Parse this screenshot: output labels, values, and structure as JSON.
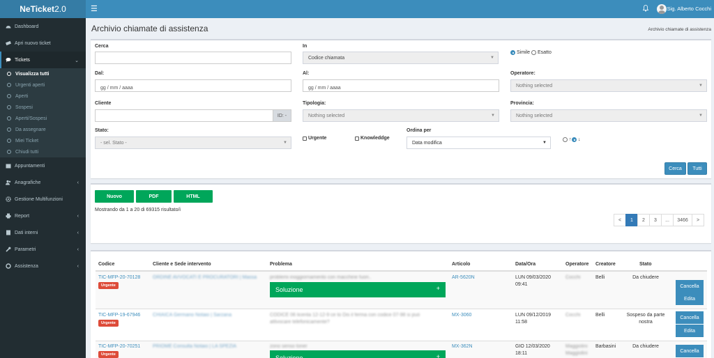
{
  "app": {
    "logo_bold": "NeTicket",
    "logo_ver": "2.0",
    "user": "Sig. Alberto Cocchi"
  },
  "sidebar": {
    "items": [
      {
        "label": "Dashboard",
        "icon": "dashboard-icon"
      },
      {
        "label": "Apri nuovo ticket",
        "icon": "ticket-icon"
      },
      {
        "label": "Tickets",
        "icon": "comments-icon"
      },
      {
        "label": "Appuntamenti",
        "icon": "calendar-icon"
      },
      {
        "label": "Anagrafiche",
        "icon": "users-icon"
      },
      {
        "label": "Gestione Multifunzioni",
        "icon": "cog-icon"
      },
      {
        "label": "Report",
        "icon": "print-icon"
      },
      {
        "label": "Dati interni",
        "icon": "book-icon"
      },
      {
        "label": "Parametri",
        "icon": "wrench-icon"
      },
      {
        "label": "Assistenza",
        "icon": "lifebuoy-icon"
      }
    ],
    "sub": [
      "Visualizza tutti",
      "Urgenti aperti",
      "Aperti",
      "Sospesi",
      "Aperti/Sospesi",
      "Da assegnare",
      "Miei Ticket",
      "Chiudi tutti"
    ]
  },
  "page": {
    "title": "Archivio chiamate di assistenza",
    "breadcrumb": "Archivio chiamate di assistenza"
  },
  "filters": {
    "cerca_label": "Cerca",
    "in_label": "In",
    "in_value": "Codice chiamata",
    "simile": "Simile",
    "esatto": "Esatto",
    "dal_label": "Dal:",
    "al_label": "Al:",
    "date_placeholder": "gg / mm / aaaa",
    "operatore_label": "Operatore:",
    "nothing": "Nothing selected",
    "cliente_label": "Cliente",
    "id_addon": "ID: -",
    "tipologia_label": "Tipologia:",
    "provincia_label": "Provincia:",
    "stato_label": "Stato:",
    "stato_value": "- sel. Stato -",
    "urgente": "Urgente",
    "knowleddge": "Knowleddge",
    "ordina_label": "Ordina per",
    "ordina_value": "Data modifica",
    "cerca_btn": "Cerca",
    "tutti_btn": "Tutti"
  },
  "results": {
    "nuovo": "Nuovo",
    "pdf": "PDF",
    "html": "HTML",
    "summary": "Mostrando da 1 a 20 di 69315 risultato/i",
    "pages": [
      "<",
      "1",
      "2",
      "3",
      "...",
      "3466",
      ">"
    ],
    "current_page": "1"
  },
  "table": {
    "headers": [
      "Codice",
      "Cliente e Sede intervento",
      "Problema",
      "Articolo",
      "Data/Ora",
      "Operatore",
      "Creatore",
      "Stato"
    ],
    "solution_label": "Soluzione",
    "cancel_label": "Cancella",
    "edit_label": "Edita",
    "rows": [
      {
        "code": "TIC-MFP-20-70128",
        "badge": "Urgente",
        "client": "ORDINE AVVOCATI E PROCURATORI | Massa",
        "problem": "problemi inoggiornamento con macchine fuori..",
        "article": "AR-5620N",
        "date1": "LUN 09/03/2020",
        "date2": "09:41",
        "operator": "Cocchi",
        "creator": "Belli",
        "state": "Da chiudere"
      },
      {
        "code": "TIC-MFP-19-67946",
        "badge": "Urgente",
        "client": "CHIAICA Germano Notaio | Sarzana",
        "problem": "CODICE 06 licenta 12-12-9 ce to Dis il ferma con codice 07-98 si può attivocare telefonicamente?",
        "article": "MX-3060",
        "date1": "LUN 09/12/2019",
        "date2": "11:58",
        "operator": "Cocchi",
        "creator": "Belli",
        "state": "Sospeso da parte nostra"
      },
      {
        "code": "TIC-MFP-20-70251",
        "badge": "Urgente",
        "client": "PRIOME Consulta Notaio | LA SPEZIA",
        "problem": "zono senso toner",
        "article": "MX-362N",
        "date1": "GIO 12/03/2020",
        "date2": "18:11",
        "operator": "Maggiolini Maggiolini",
        "creator": "Barbasini",
        "state": "Da chiudere"
      }
    ]
  }
}
